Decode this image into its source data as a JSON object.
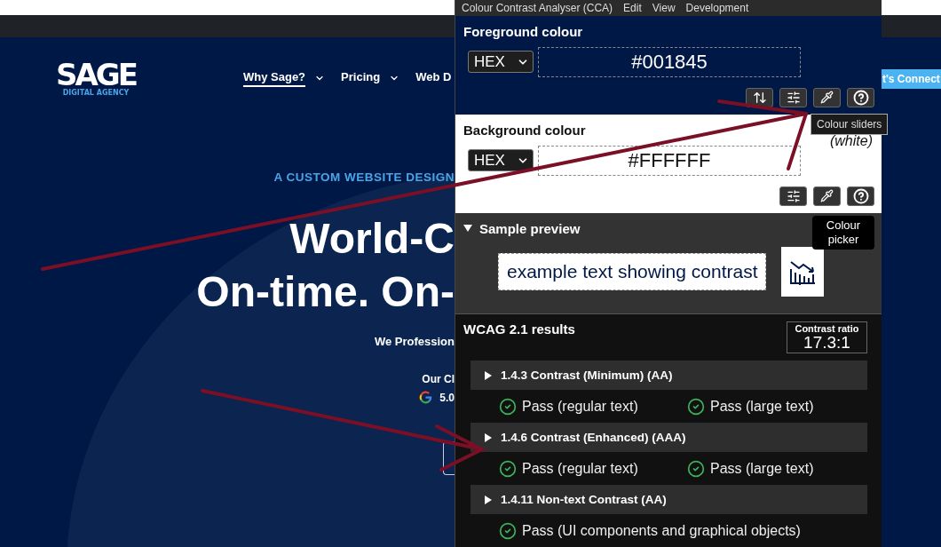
{
  "website": {
    "logo": {
      "wordmark": "SAGE",
      "tagline": "DIGITAL AGENCY"
    },
    "nav": [
      {
        "label": "Why Sage?",
        "selected": true,
        "dropdown": true
      },
      {
        "label": "Pricing",
        "selected": false,
        "dropdown": true
      },
      {
        "label": "Web D",
        "selected": false,
        "dropdown": false
      }
    ],
    "cta": "t's Connect",
    "eyebrow": "A CUSTOM WEBSITE DESIGN",
    "headline": [
      "World-C",
      "On-time. On-"
    ],
    "subtitle": "We Profession",
    "reviews_label": "Our Cl",
    "rating": "5.0"
  },
  "cca": {
    "menu": [
      "Colour Contrast Analyser (CCA)",
      "Edit",
      "View",
      "Development"
    ],
    "foreground": {
      "title": "Foreground colour",
      "format": "HEX",
      "value": "#001845",
      "tools": [
        {
          "kind": "swap"
        },
        {
          "kind": "sliders"
        },
        {
          "kind": "picker"
        },
        {
          "kind": "help"
        }
      ]
    },
    "background": {
      "title": "Background colour",
      "name": "(white)",
      "format": "HEX",
      "value": "#FFFFFF",
      "tools": [
        {
          "kind": "sliders"
        },
        {
          "kind": "picker"
        },
        {
          "kind": "help"
        }
      ]
    },
    "preview": {
      "title": "Sample preview",
      "expanded": true,
      "sample": "example text showing contrast"
    },
    "results": {
      "title": "WCAG 2.1 results",
      "ratio_label": "Contrast ratio",
      "ratio": "17.3:1",
      "criteria": [
        {
          "title": "1.4.3 Contrast (Minimum) (AA)",
          "expanded": false,
          "checks": [
            {
              "label": "Pass (regular text)",
              "passed": true
            },
            {
              "label": "Pass (large text)",
              "passed": true
            }
          ]
        },
        {
          "title": "1.4.6 Contrast (Enhanced) (AAA)",
          "expanded": false,
          "checks": [
            {
              "label": "Pass (regular text)",
              "passed": true
            },
            {
              "label": "Pass (large text)",
              "passed": true
            }
          ]
        },
        {
          "title": "1.4.11 Non-text Contrast (AA)",
          "expanded": false,
          "checks": [
            {
              "label": "Pass (UI components and graphical objects)",
              "passed": true
            }
          ]
        }
      ]
    }
  },
  "tooltips": [
    {
      "text": "Colour sliders"
    },
    {
      "text": "Colour picker"
    }
  ]
}
